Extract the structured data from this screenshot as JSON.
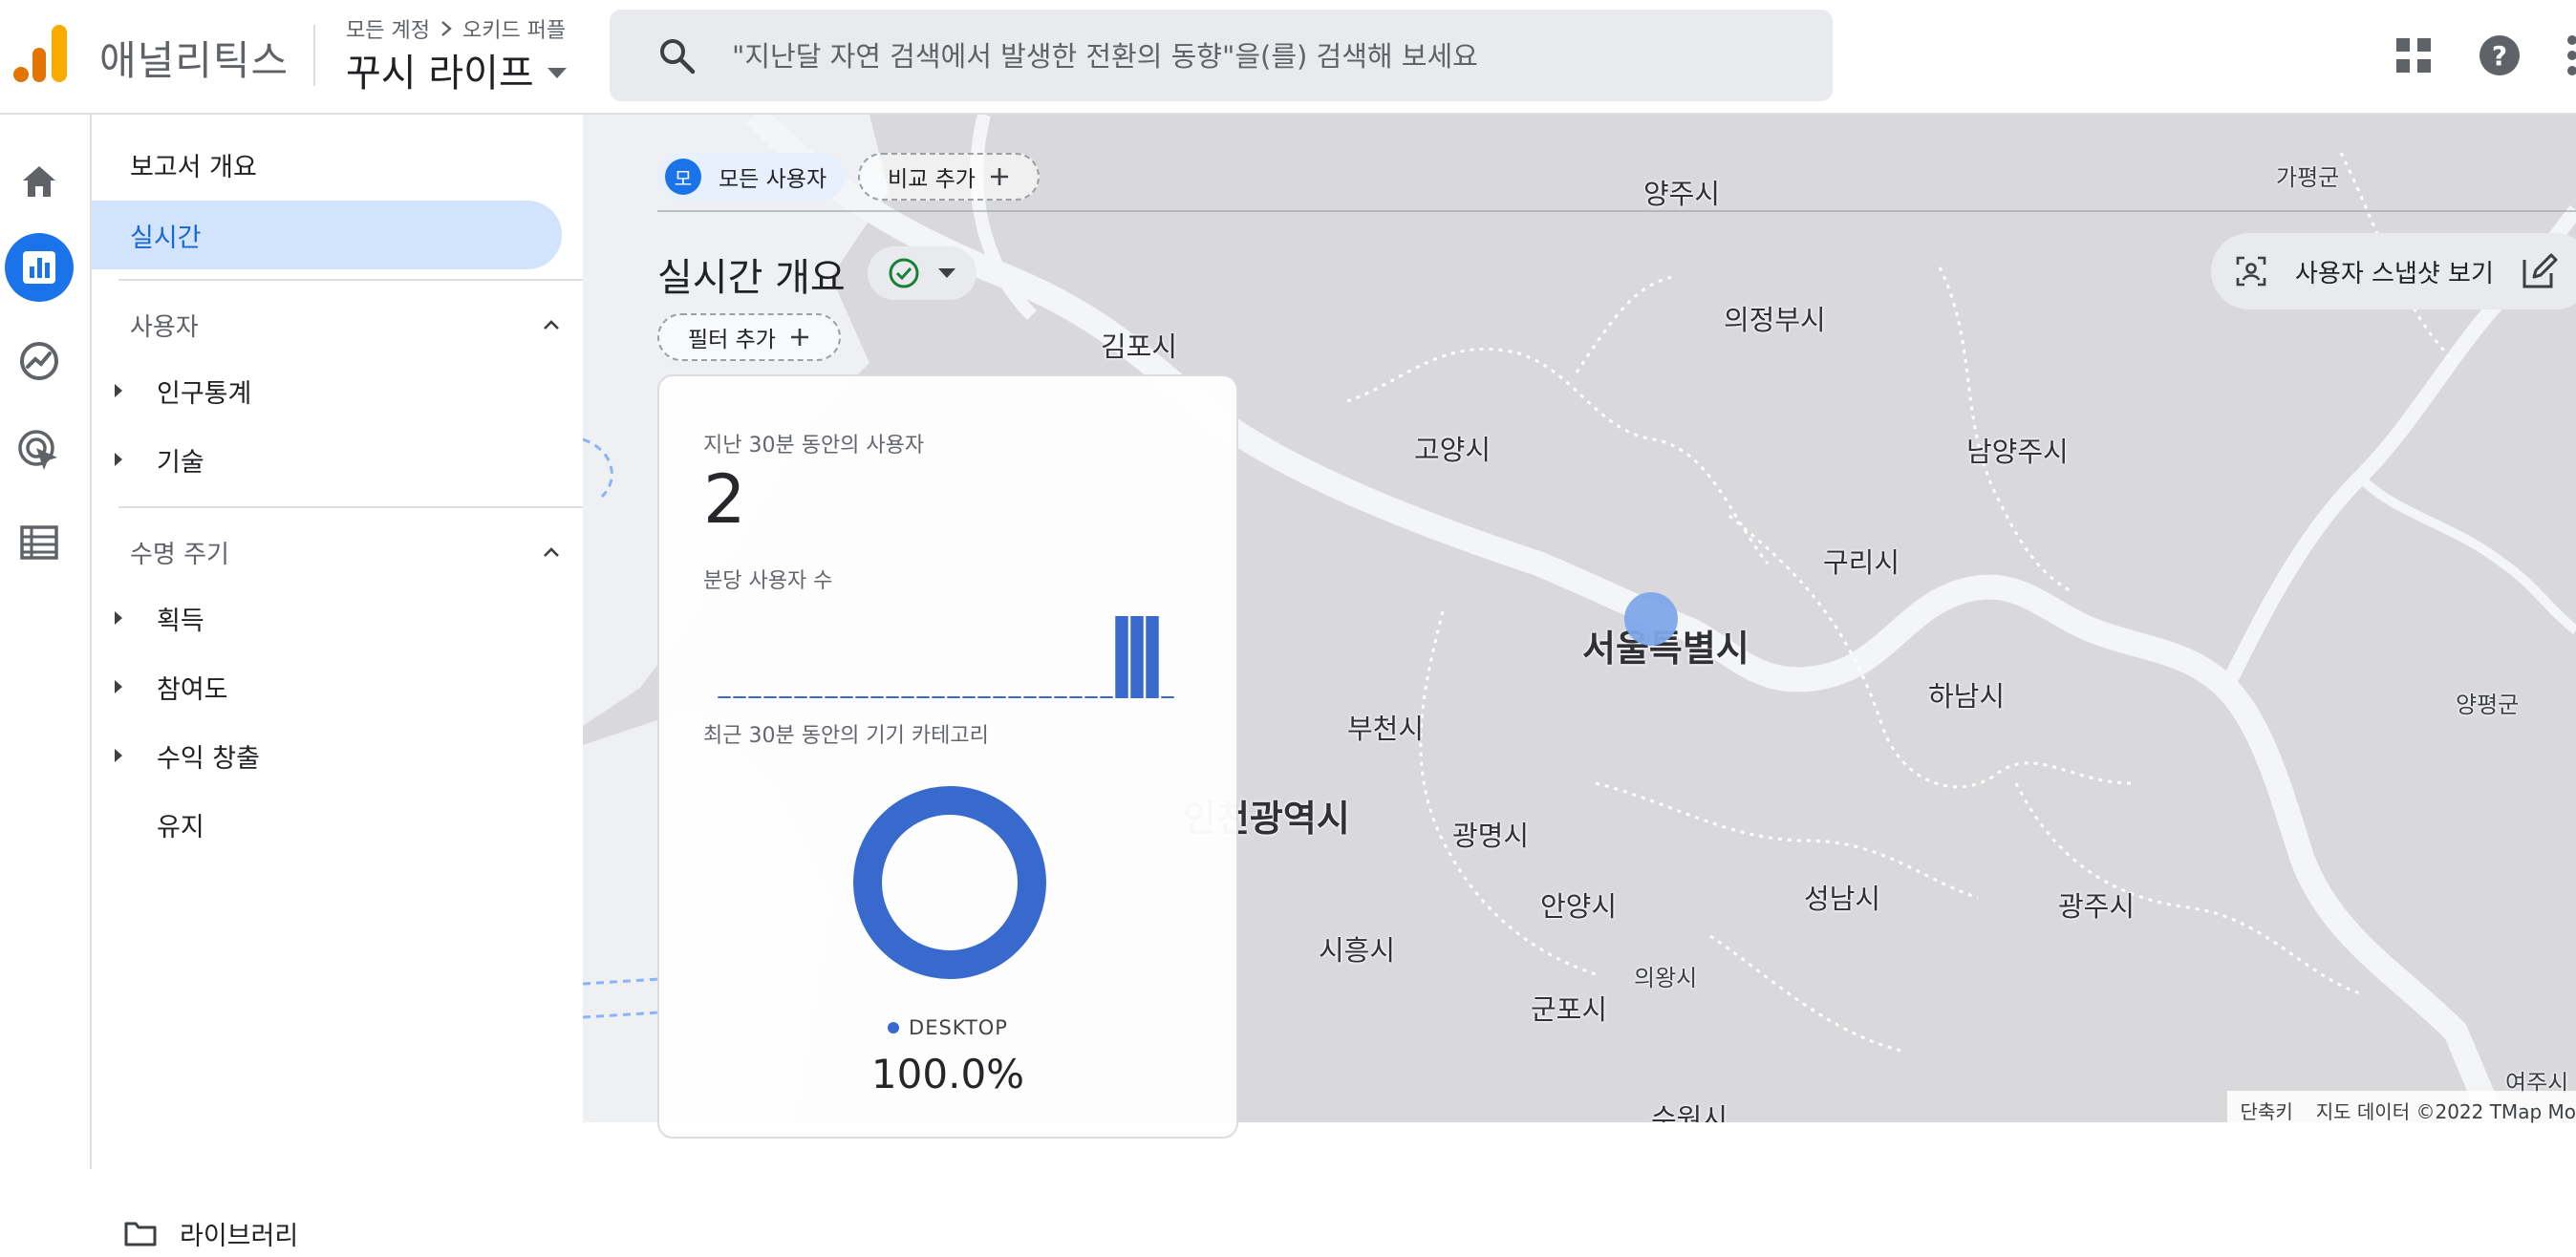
{
  "header": {
    "app_name": "애널리틱스",
    "breadcrumb": [
      "모든 계정",
      "오키드 퍼플"
    ],
    "property": "꾸시 라이프",
    "search_placeholder": "\"지난달 자연 검색에서 발생한 전환의 동향\"을(를) 검색해 보세요",
    "search_value": "",
    "icons": [
      "analytics-logo-icon",
      "search-icon",
      "apps-grid-icon",
      "help-icon",
      "more-vert-icon"
    ]
  },
  "rail": {
    "icons": [
      "home-icon",
      "reports-icon",
      "explore-icon",
      "advertising-icon",
      "configure-icon"
    ],
    "active": "reports-icon"
  },
  "sidebar": {
    "overview": "보고서 개요",
    "realtime": "실시간",
    "sections": [
      {
        "title": "사용자",
        "items": [
          {
            "label": "인구통계",
            "expandable": true
          },
          {
            "label": "기술",
            "expandable": true
          }
        ]
      },
      {
        "title": "수명 주기",
        "items": [
          {
            "label": "획득",
            "expandable": true
          },
          {
            "label": "참여도",
            "expandable": true
          },
          {
            "label": "수익 창출",
            "expandable": true
          },
          {
            "label": "유지",
            "expandable": false
          }
        ]
      }
    ],
    "library": "라이브러리"
  },
  "toolbar": {
    "segment_avatar": "모",
    "segment_label": "모든 사용자",
    "compare_label": "비교 추가",
    "page_title": "실시간 개요",
    "filter_label": "필터 추가",
    "snapshot_label": "사용자 스냅샷 보기"
  },
  "card": {
    "users_label": "지난 30분 동안의 사용자",
    "users_value": "2",
    "per_minute_label": "분당 사용자 수",
    "per_minute": [
      0,
      0,
      0,
      0,
      0,
      0,
      0,
      0,
      0,
      0,
      0,
      0,
      0,
      0,
      0,
      0,
      0,
      0,
      0,
      0,
      0,
      0,
      0,
      0,
      0,
      0,
      1,
      1,
      1,
      0
    ],
    "device_label": "최근 30분 동안의 기기 카테고리",
    "device_category": "DESKTOP",
    "device_share": "100.0%",
    "colors": {
      "accent": "#3366cc",
      "primary": "#1a73e8"
    }
  },
  "map": {
    "labels": {
      "yangju": "양주시",
      "gapyeong": "가평군",
      "uijeongbu": "의정부시",
      "gimpo": "김포시",
      "goyang": "고양시",
      "namyangju": "남양주시",
      "guri": "구리시",
      "seoul": "서울특별시",
      "hanam": "하남시",
      "yangpyeong": "양평군",
      "bucheon": "부천시",
      "incheon": "인천광역시",
      "gwangmyeong": "광명시",
      "anyang": "안양시",
      "seongnam": "성남시",
      "gwangju": "광주시",
      "siheung": "시흥시",
      "uiwang": "의왕시",
      "gunpo": "군포시",
      "yeoju": "여주시",
      "suwon": "수원시"
    },
    "shortcuts": "단축키",
    "copyright": "지도 데이터 ©2022 TMap Mo"
  }
}
